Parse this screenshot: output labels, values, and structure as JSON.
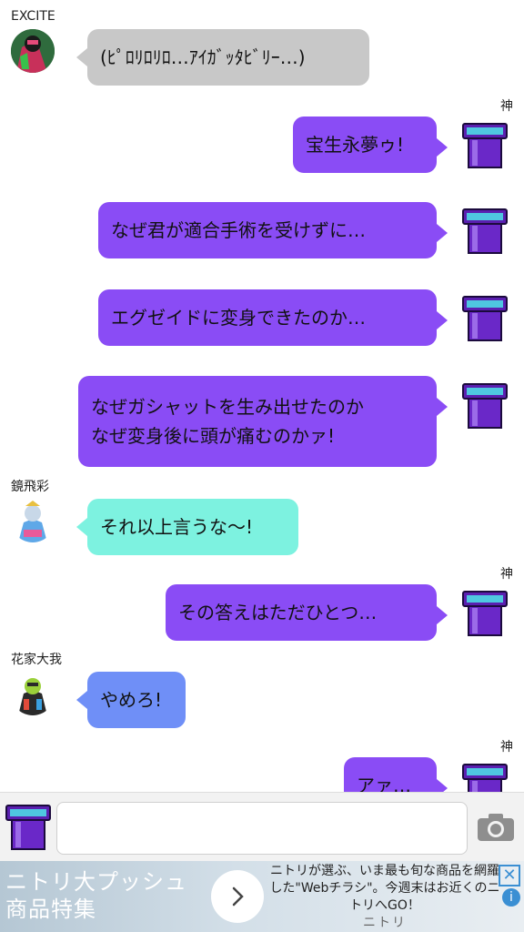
{
  "colors": {
    "purple": "#8a4cf5",
    "gray": "#c8c8c8",
    "cyan": "#7df2e0",
    "blue": "#6f8ff7"
  },
  "messages": [
    {
      "sender": "EXCITE",
      "text": "(ﾋﾟﾛﾘﾛﾘﾛ…ｱｲｶﾞｯﾀﾋﾞﾘｰ…)"
    },
    {
      "sender": "神",
      "text": "宝生永夢ゥ!"
    },
    {
      "text": "なぜ君が適合手術を受けずに…"
    },
    {
      "text": "エグゼイドに変身できたのか…"
    },
    {
      "lines": [
        "なぜガシャットを生み出せたのか",
        "なぜ変身後に頭が痛むのかァ!"
      ]
    },
    {
      "sender": "鏡飛彩",
      "text": "それ以上言うな～!"
    },
    {
      "sender": "神",
      "text": "その答えはただひとつ…"
    },
    {
      "sender": "花家大我",
      "text": "やめろ!"
    },
    {
      "sender": "神",
      "text": "アァ…"
    }
  ],
  "input": {
    "placeholder": "",
    "camera_icon": "camera-icon"
  },
  "ad": {
    "left_lines": [
      "ニトリ大プッシュ",
      "商品特集"
    ],
    "right_text": "ニトリが選ぶ、いま最も旬な商品を網羅した\"Webチラシ\"。今週末はお近くのニトリへGO！",
    "brand": "ニトリ",
    "close": "✕",
    "info": "i"
  }
}
